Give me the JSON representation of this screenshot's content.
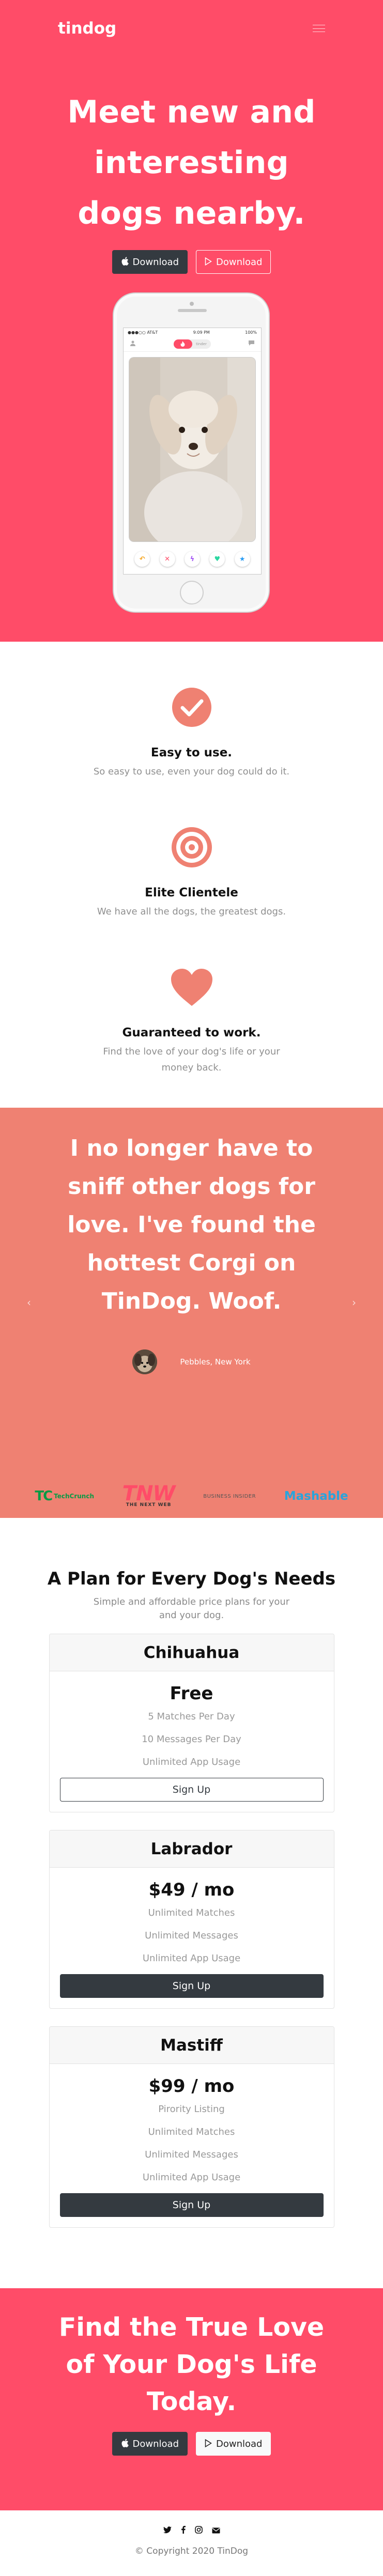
{
  "nav": {
    "brand": "tindog",
    "menu_icon": "hamburger-icon"
  },
  "hero": {
    "title": "Meet new and interesting dogs nearby.",
    "download_dark": "Download",
    "download_outline": "Download"
  },
  "phone": {
    "carrier": "●●●○○ AT&T",
    "time": "9:09 PM",
    "battery": "100%",
    "toggle_off": "tinder"
  },
  "features": [
    {
      "icon": "check-circle-icon",
      "title": "Easy to use.",
      "text": "So easy to use, even your dog could do it."
    },
    {
      "icon": "bullseye-icon",
      "title": "Elite Clientele",
      "text": "We have all the dogs, the greatest dogs."
    },
    {
      "icon": "heart-icon",
      "title": "Guaranteed to work.",
      "text": "Find the love of your dog's life or your money back."
    }
  ],
  "testimonial": {
    "quote": "I no longer have to sniff other dogs for love. I've found the hottest Corgi on TinDog. Woof.",
    "author": "Pebbles, New York"
  },
  "press": {
    "techcrunch": "TechCrunch",
    "tnw_big": "TNW",
    "tnw_small": "THE NEXT WEB",
    "business_insider": "BUSINESS INSIDER",
    "mashable": "Mashable"
  },
  "pricing": {
    "title": "A Plan for Every Dog's Needs",
    "subtitle": "Simple and affordable price plans for your and your dog.",
    "plans": [
      {
        "name": "Chihuahua",
        "price": "Free",
        "features": [
          "5 Matches Per Day",
          "10 Messages Per Day",
          "Unlimited App Usage"
        ],
        "button": "Sign Up"
      },
      {
        "name": "Labrador",
        "price": "$49 / mo",
        "features": [
          "Unlimited Matches",
          "Unlimited Messages",
          "Unlimited App Usage"
        ],
        "button": "Sign Up"
      },
      {
        "name": "Mastiff",
        "price": "$99 / mo",
        "features": [
          "Pirority Listing",
          "Unlimited Matches",
          "Unlimited Messages",
          "Unlimited App Usage"
        ],
        "button": "Sign Up"
      }
    ]
  },
  "cta": {
    "title": "Find the True Love of Your Dog's Life Today.",
    "download_dark": "Download",
    "download_light": "Download"
  },
  "footer": {
    "social": [
      "twitter-icon",
      "facebook-icon",
      "instagram-icon",
      "email-icon"
    ],
    "copyright": "© Copyright 2020 TinDog"
  },
  "colors": {
    "brand_red": "#ff4c68",
    "testimonial_bg": "#ef8172",
    "dark": "#343a40"
  }
}
